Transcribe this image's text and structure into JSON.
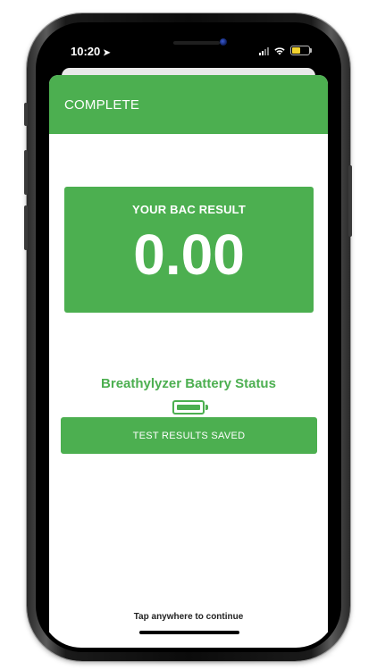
{
  "status_bar": {
    "time": "10:20",
    "location_icon": "location-arrow-icon",
    "signal_icon": "cellular-signal-icon",
    "wifi_icon": "wifi-icon",
    "battery_icon": "battery-icon"
  },
  "header": {
    "title": "COMPLETE"
  },
  "result": {
    "label": "YOUR BAC RESULT",
    "value": "0.00"
  },
  "battery": {
    "title": "Breathylyzer Battery Status",
    "icon": "battery-full-icon",
    "level": 1.0
  },
  "saved_button": {
    "label": "TEST RESULTS SAVED"
  },
  "footer": {
    "hint": "Tap anywhere to continue"
  },
  "colors": {
    "accent": "#4caf50",
    "status_battery": "#f2d22e"
  }
}
